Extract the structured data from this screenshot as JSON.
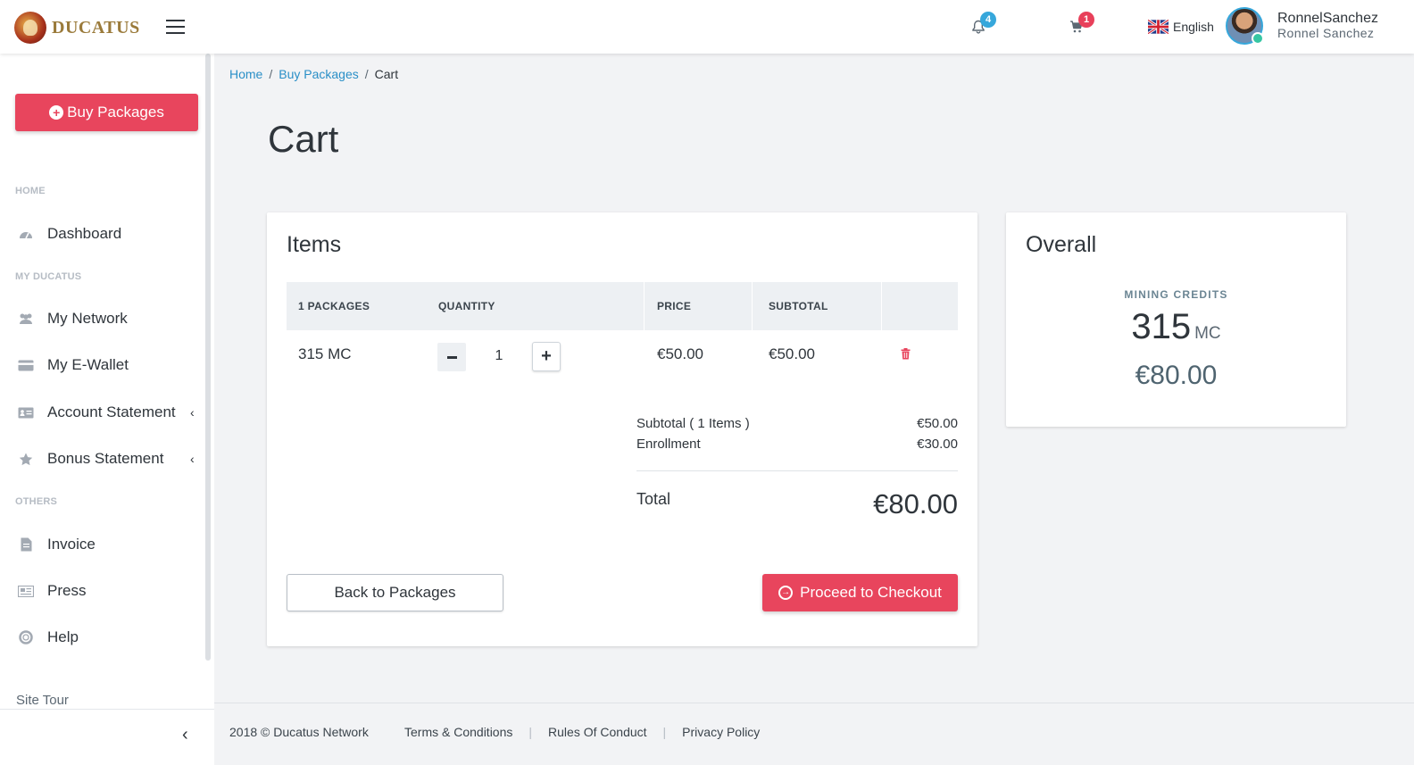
{
  "header": {
    "brand": "DUCATUS",
    "notifications_count": "4",
    "cart_count": "1",
    "language": "English",
    "user_login": "RonnelSanchez",
    "user_fullname": "Ronnel Sanchez"
  },
  "sidebar": {
    "buy_button": "Buy Packages",
    "headings": {
      "home": "HOME",
      "my_ducatus": "MY DUCATUS",
      "others": "OTHERS"
    },
    "items": {
      "dashboard": "Dashboard",
      "my_network": "My Network",
      "my_ewallet": "My E-Wallet",
      "account_statement": "Account Statement",
      "bonus_statement": "Bonus Statement",
      "invoice": "Invoice",
      "press": "Press",
      "help": "Help"
    },
    "site_tour": "Site Tour"
  },
  "breadcrumb": {
    "home": "Home",
    "buy_packages": "Buy Packages",
    "current": "Cart"
  },
  "page": {
    "title": "Cart"
  },
  "items_card": {
    "title": "Items",
    "columns": {
      "packages": "1 PACKAGES",
      "quantity": "QUANTITY",
      "price": "PRICE",
      "subtotal": "SUBTOTAL"
    },
    "row": {
      "package": "315 MC",
      "quantity": "1",
      "price": "€50.00",
      "subtotal": "€50.00"
    },
    "summary": {
      "subtotal_label": "Subtotal ( 1 Items )",
      "subtotal_value": "€50.00",
      "enrollment_label": "Enrollment",
      "enrollment_value": "€30.00",
      "total_label": "Total",
      "total_value": "€80.00"
    },
    "back_button": "Back to Packages",
    "checkout_button": "Proceed to Checkout"
  },
  "overall_card": {
    "title": "Overall",
    "credits_label": "MINING CREDITS",
    "credits_value": "315",
    "credits_unit": "MC",
    "price": "€80.00"
  },
  "footer": {
    "copyright": "2018 © Ducatus Network",
    "links": {
      "terms": "Terms & Conditions",
      "rules": "Rules Of Conduct",
      "privacy": "Privacy Policy"
    }
  },
  "colors": {
    "accent_red": "#e8455d",
    "link_blue": "#2a8fc7",
    "badge_blue": "#36a7db",
    "online_green": "#36c6a3"
  },
  "icons": {
    "notifications": "bell-icon",
    "cart": "cart-icon",
    "delete": "trash-icon",
    "checkout": "arrow-circle-right-icon"
  }
}
